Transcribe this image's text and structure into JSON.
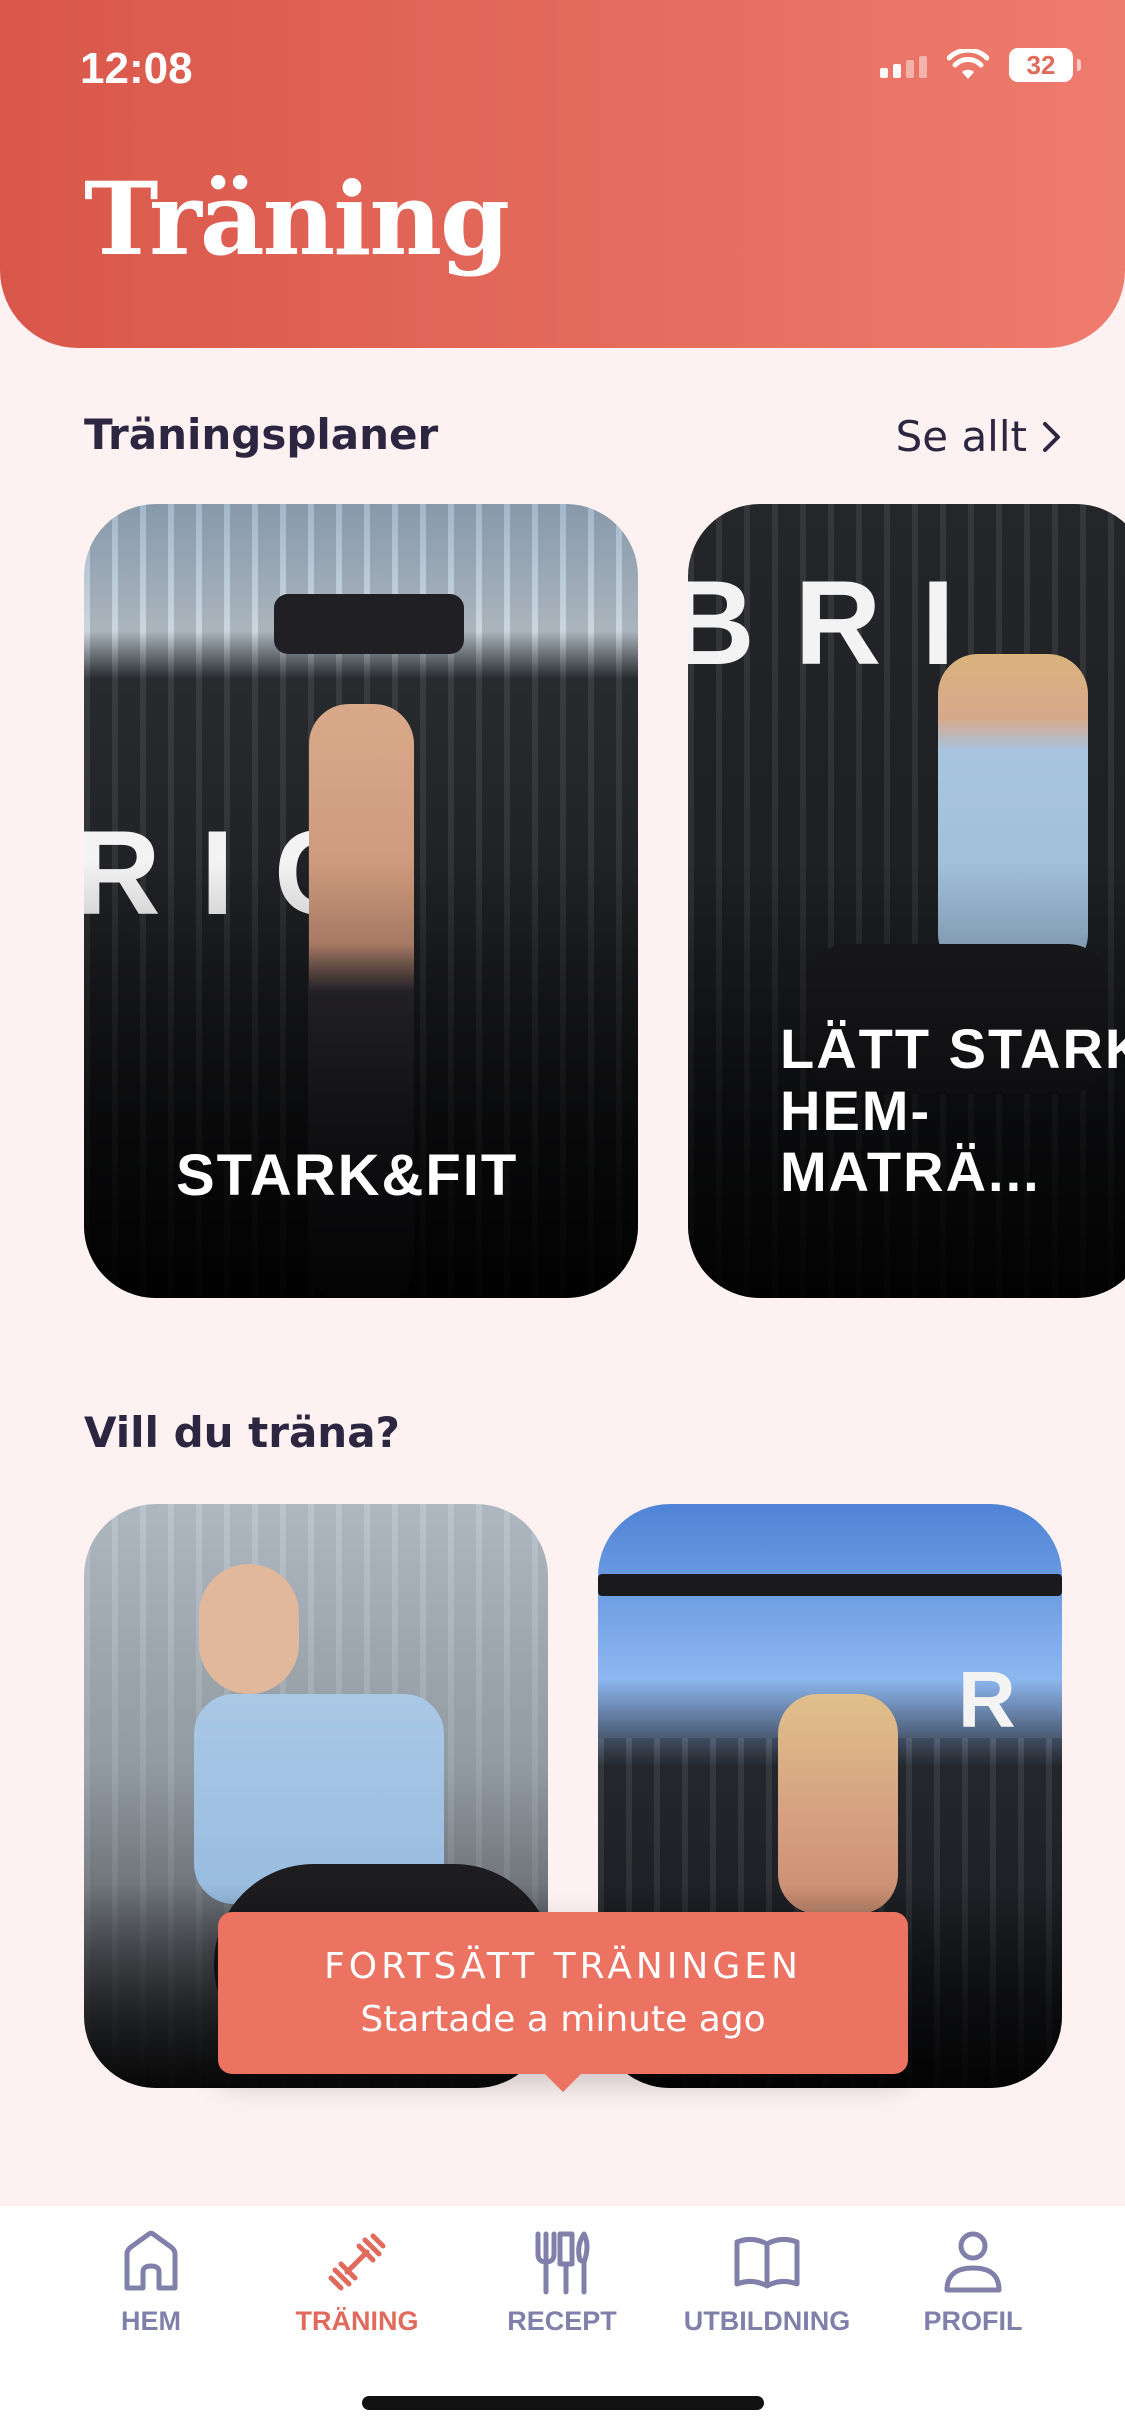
{
  "status_bar": {
    "time": "12:08",
    "battery": "32"
  },
  "header": {
    "title": "Träning"
  },
  "plans_section": {
    "title": "Träningsplaner",
    "see_all": "Se allt",
    "cards": [
      {
        "label": "STARK&FIT"
      },
      {
        "label_lines": [
          "LÄTT STARK",
          "HEM-",
          "MATRÄ..."
        ]
      }
    ]
  },
  "workout_section": {
    "title": "Vill du träna?"
  },
  "toast": {
    "title": "FORTSÄTT TRÄNINGEN",
    "subtitle": "Startade a minute ago"
  },
  "tabbar": {
    "items": [
      {
        "label": "HEM",
        "icon": "home-icon",
        "active": false
      },
      {
        "label": "TRÄNING",
        "icon": "dumbbell-icon",
        "active": true
      },
      {
        "label": "RECEPT",
        "icon": "cutlery-icon",
        "active": false
      },
      {
        "label": "UTBILDNING",
        "icon": "book-icon",
        "active": false
      },
      {
        "label": "PROFIL",
        "icon": "person-icon",
        "active": false
      }
    ]
  },
  "colors": {
    "accent": "#e06a5b",
    "background": "#fdf1f1",
    "tab_inactive": "#8080ab"
  }
}
